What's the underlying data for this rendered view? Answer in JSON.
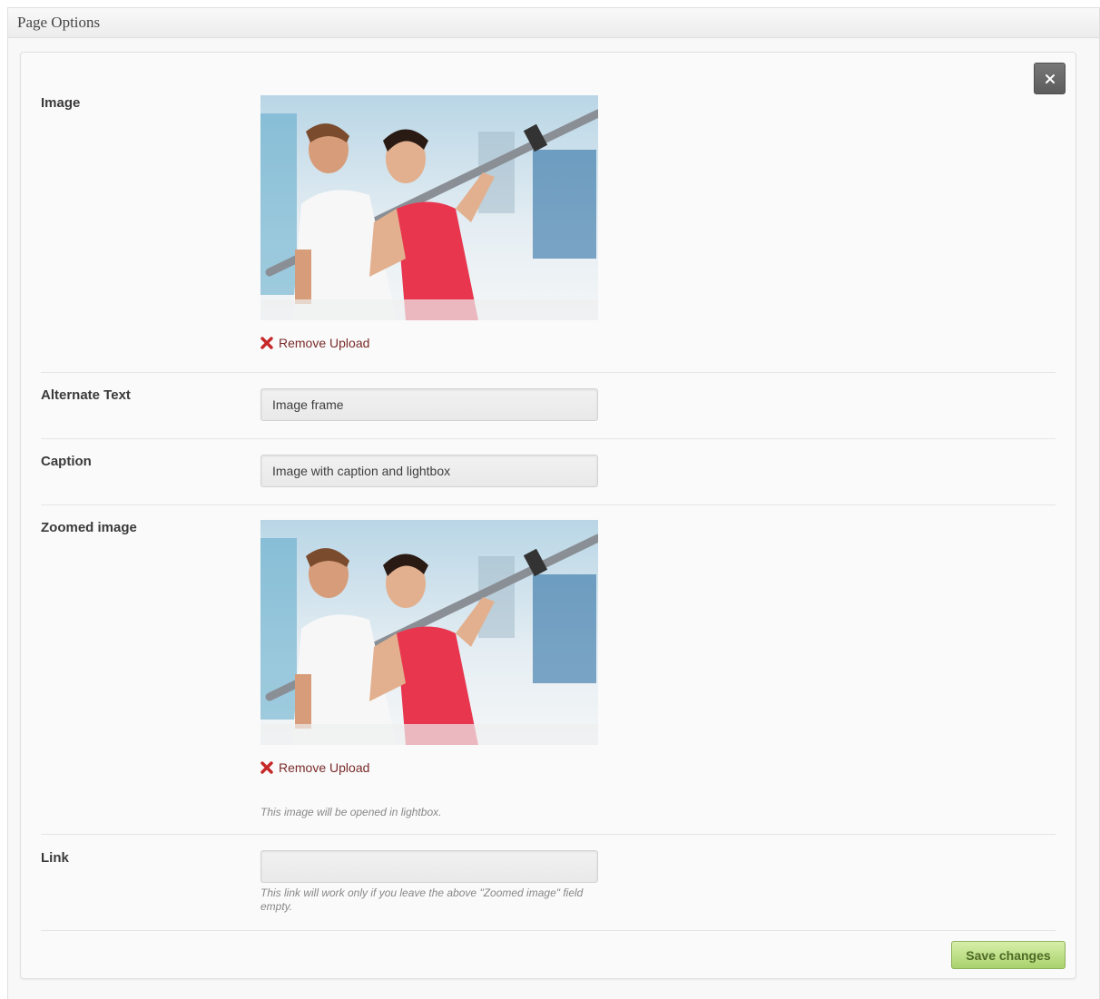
{
  "metabox": {
    "title": "Page Options"
  },
  "fields": {
    "image": {
      "label": "Image",
      "remove_label": "Remove Upload"
    },
    "alt_text": {
      "label": "Alternate Text",
      "value": "Image frame"
    },
    "caption": {
      "label": "Caption",
      "value": "Image with caption and lightbox"
    },
    "zoomed_image": {
      "label": "Zoomed image",
      "remove_label": "Remove Upload",
      "hint": "This image will be opened in lightbox."
    },
    "link": {
      "label": "Link",
      "value": "",
      "hint": "This link will work only if you leave the above \"Zoomed image\" field empty."
    }
  },
  "actions": {
    "save_label": "Save changes"
  },
  "icons": {
    "close": "close-icon",
    "remove": "remove-x-icon"
  },
  "colors": {
    "save_button": "#a9d26d",
    "remove_icon": "#c62828",
    "close_button": "#5c5c5c"
  }
}
